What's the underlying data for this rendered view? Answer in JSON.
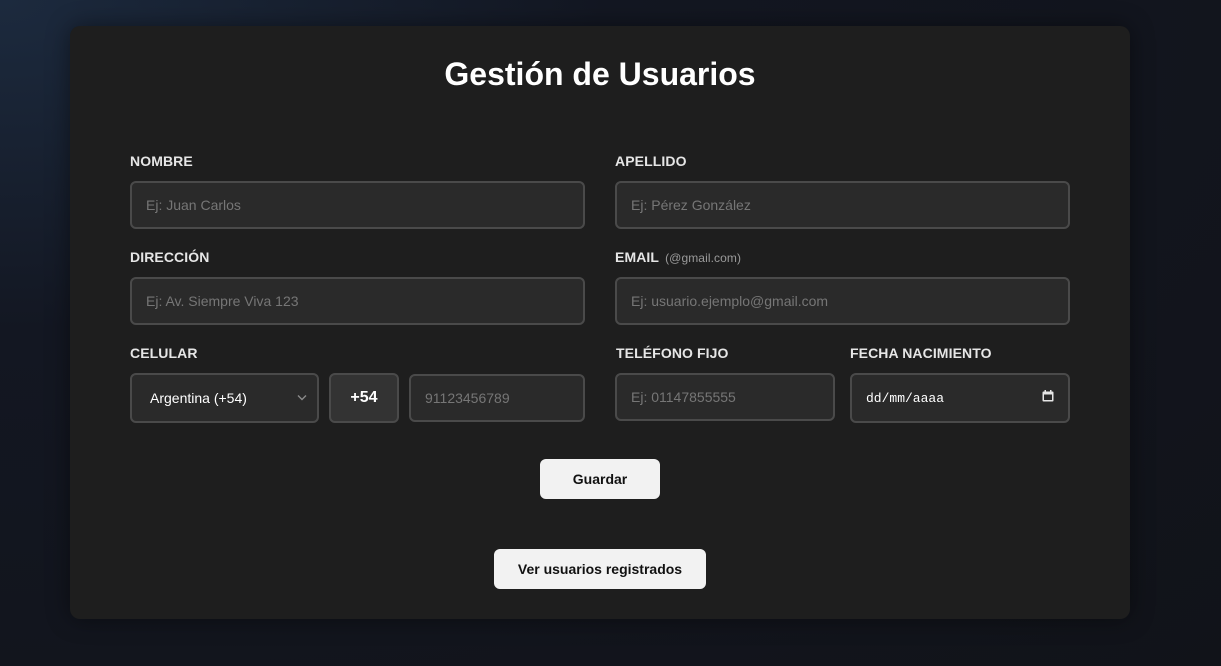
{
  "form": {
    "title": "Gestión de Usuarios",
    "nombre": {
      "label": "NOMBRE",
      "placeholder": "Ej: Juan Carlos",
      "value": ""
    },
    "apellido": {
      "label": "APELLIDO",
      "placeholder": "Ej: Pérez González",
      "value": ""
    },
    "direccion": {
      "label": "DIRECCIÓN",
      "placeholder": "Ej: Av. Siempre Viva 123",
      "value": ""
    },
    "email": {
      "label": "EMAIL",
      "hint": "(@gmail.com)",
      "placeholder": "Ej: usuario.ejemplo@gmail.com",
      "value": ""
    },
    "celular": {
      "label": "CELULAR",
      "country_selected": "Argentina (+54)",
      "prefix": "+54",
      "placeholder": "91123456789",
      "value": ""
    },
    "telefono_fijo": {
      "label": "TELÉFONO FIJO",
      "placeholder": "Ej: 01147855555",
      "value": ""
    },
    "fecha_nacimiento": {
      "label": "FECHA NACIMIENTO",
      "display": "dd/mm/aaaa"
    },
    "save_label": "Guardar",
    "view_users_label": "Ver usuarios registrados"
  },
  "icons": {
    "select_chevron": "chevron-down-icon",
    "date_picker": "calendar-icon"
  },
  "colors": {
    "background": "#111319",
    "card": "#1e1e1e",
    "input_bg": "#2a2a2a",
    "input_border": "#4a4a4a",
    "button_bg": "#f2f2f2",
    "text": "#ffffff"
  }
}
